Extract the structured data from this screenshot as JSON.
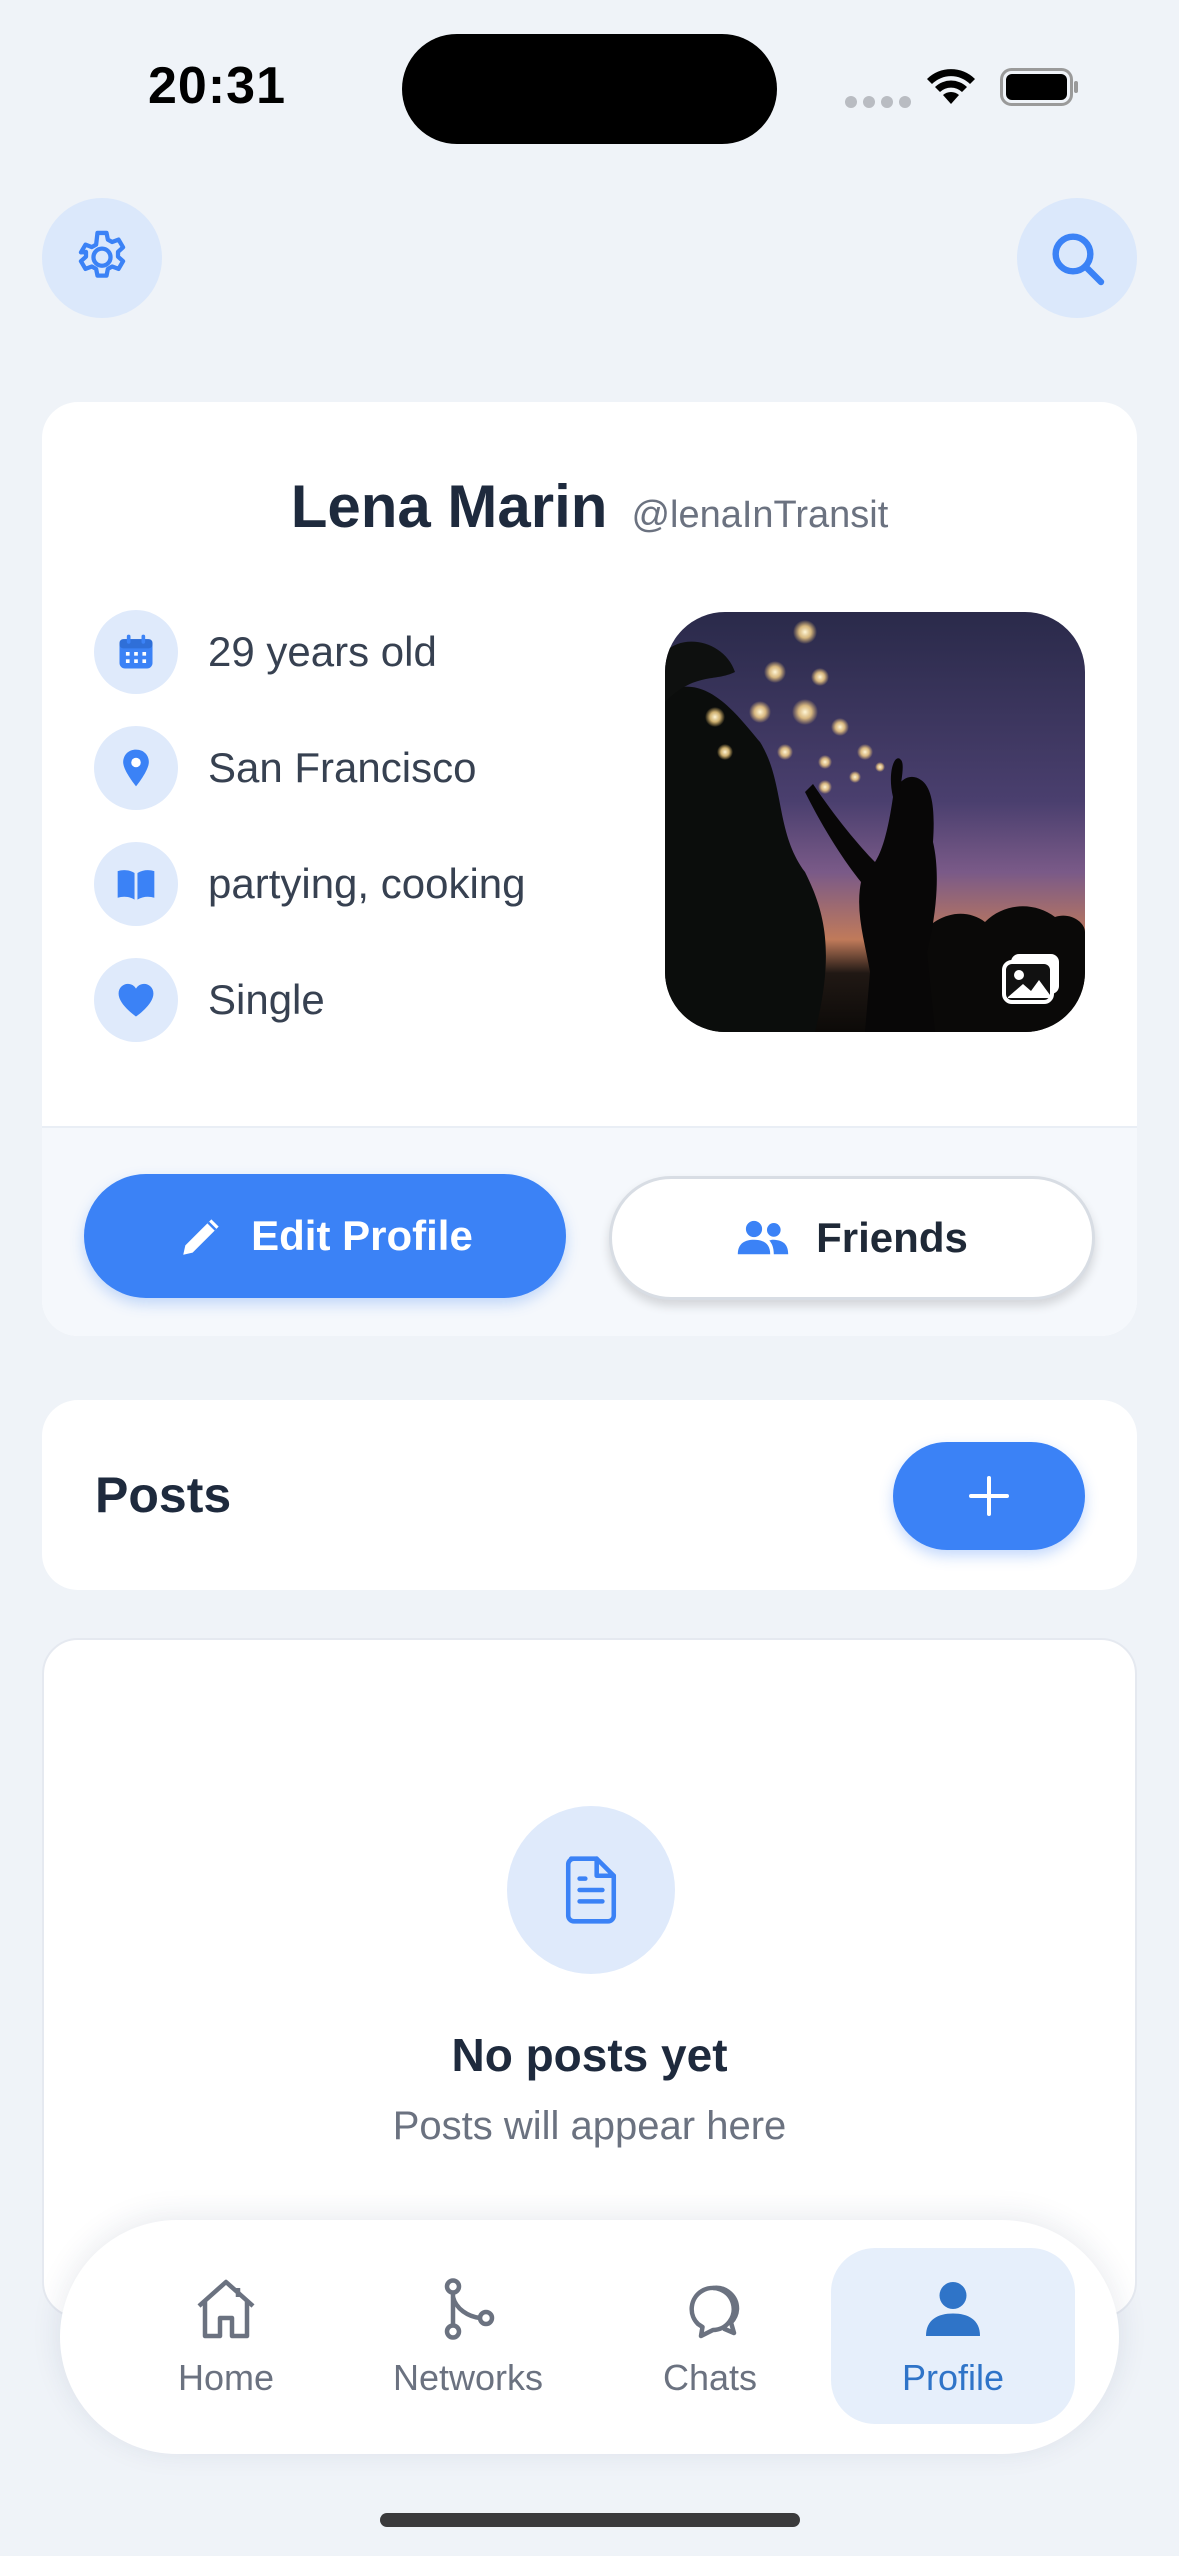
{
  "status_bar": {
    "time": "20:31"
  },
  "header": {
    "settings_icon": "gear-icon",
    "search_icon": "search-icon"
  },
  "profile": {
    "name": "Lena Marin",
    "handle": "@lenaInTransit",
    "info": [
      {
        "icon": "calendar-icon",
        "text": "29 years old"
      },
      {
        "icon": "location-pin-icon",
        "text": "San Francisco"
      },
      {
        "icon": "book-icon",
        "text": "partying, cooking"
      },
      {
        "icon": "heart-icon",
        "text": "Single"
      }
    ],
    "edit_label": "Edit Profile",
    "friends_label": "Friends"
  },
  "posts": {
    "title": "Posts",
    "empty_title": "No posts yet",
    "empty_subtitle": "Posts will appear here"
  },
  "tabs": [
    {
      "label": "Home",
      "icon": "home-icon",
      "active": false
    },
    {
      "label": "Networks",
      "icon": "network-icon",
      "active": false
    },
    {
      "label": "Chats",
      "icon": "chat-icon",
      "active": false
    },
    {
      "label": "Profile",
      "icon": "user-icon",
      "active": true
    }
  ],
  "colors": {
    "accent": "#3b82f6",
    "background": "#eff3f8",
    "active_tab": "#2f74c8"
  }
}
